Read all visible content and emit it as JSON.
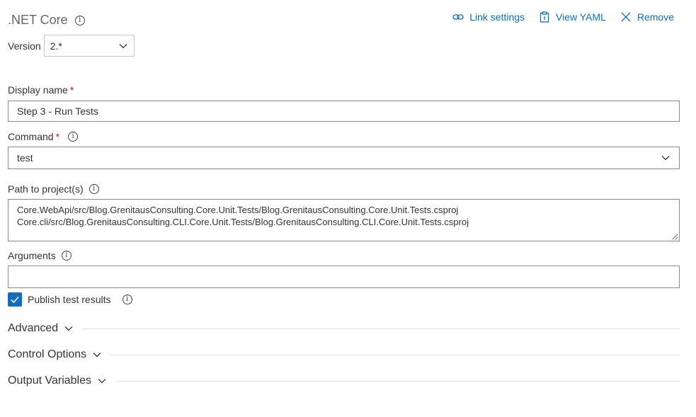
{
  "header": {
    "title": ".NET Core"
  },
  "actions": {
    "link_settings": "Link settings",
    "view_yaml": "View YAML",
    "remove": "Remove"
  },
  "version": {
    "label": "Version",
    "value": "2.*"
  },
  "display_name": {
    "label": "Display name",
    "required_mark": "*",
    "value": "Step 3 - Run Tests"
  },
  "command": {
    "label": "Command",
    "required_mark": "*",
    "value": "test"
  },
  "path": {
    "label": "Path to project(s)",
    "lines": [
      "Core.WebApi/src/Blog.GrenitausConsulting.Core.Unit.Tests/Blog.GrenitausConsulting.Core.Unit.Tests.csproj",
      "Core.cli/src/Blog.GrenitausConsulting.CLI.Core.Unit.Tests/Blog.GrenitausConsulting.CLI.Core.Unit.Tests.csproj"
    ]
  },
  "arguments": {
    "label": "Arguments",
    "value": ""
  },
  "publish": {
    "label": "Publish test results",
    "checked": true
  },
  "sections": {
    "advanced": "Advanced",
    "control_options": "Control Options",
    "output_variables": "Output Variables"
  },
  "colors": {
    "accent": "#106ebe",
    "required": "#a4262c",
    "border": "#8a8a8a"
  },
  "icons": {
    "info": "info-icon",
    "link": "link-icon",
    "yaml": "clipboard-icon",
    "remove": "close-icon",
    "chevron": "chevron-down-icon",
    "check": "checkmark-icon"
  }
}
